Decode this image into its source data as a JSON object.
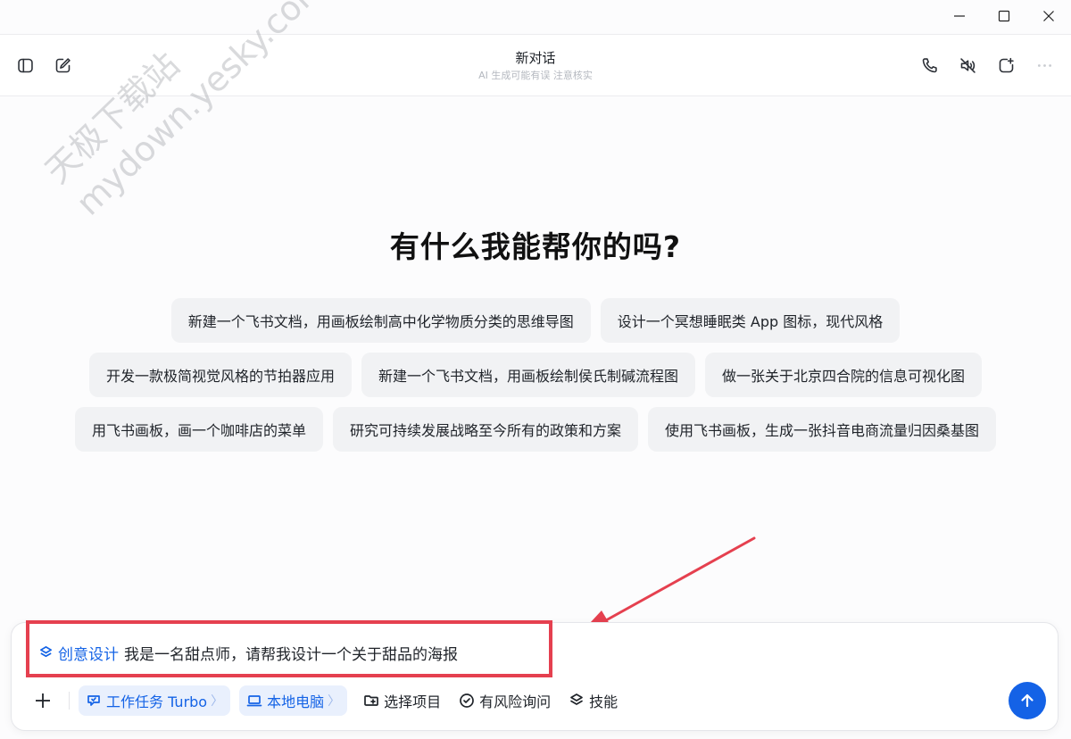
{
  "window": {
    "controls": [
      "minimize-icon",
      "maximize-icon",
      "close-icon"
    ]
  },
  "header": {
    "title": "新对话",
    "subtitle": "AI 生成可能有误 注意核实",
    "left_icons": [
      "sidebar-toggle-icon",
      "new-chat-icon"
    ],
    "right_icons": [
      "phone-icon",
      "mute-icon",
      "new-window-icon",
      "more-icon"
    ]
  },
  "watermark": {
    "line1": "天极下载站",
    "line2": "mydown.yesky.com"
  },
  "main": {
    "heading": "有什么我能帮你的吗?",
    "suggestions": {
      "row1": [
        "新建一个飞书文档，用画板绘制高中化学物质分类的思维导图",
        "设计一个冥想睡眠类 App 图标，现代风格"
      ],
      "row2": [
        "开发一款极简视觉风格的节拍器应用",
        "新建一个飞书文档，用画板绘制侯氏制碱流程图",
        "做一张关于北京四合院的信息可视化图"
      ],
      "row3": [
        "用飞书画板，画一个咖啡店的菜单",
        "研究可持续发展战略至今所有的政策和方案",
        "使用飞书画板，生成一张抖音电商流量归因桑基图"
      ]
    }
  },
  "composer": {
    "skill_tag": "创意设计",
    "prompt": "我是一名甜点师，请帮我设计一个关于甜品的海报",
    "mode_pill": "工作任务 Turbo",
    "device_pill": "本地电脑",
    "pill_chevron": "〉",
    "tools": {
      "select_project": "选择项目",
      "risk_inquiry": "有风险询问",
      "skills": "技能"
    }
  },
  "colors": {
    "accent": "#1462e6",
    "highlight_box": "#e5404f",
    "chip_bg": "#f1f2f4"
  }
}
